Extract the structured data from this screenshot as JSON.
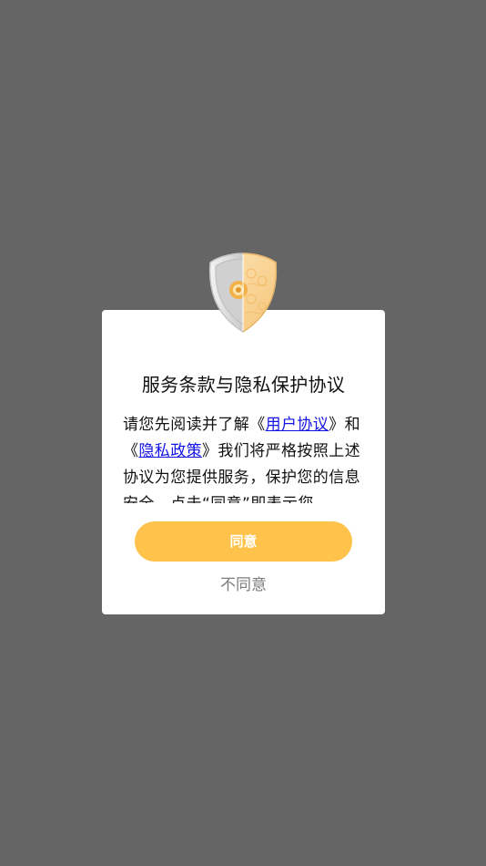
{
  "dialog": {
    "title": "服务条款与隐私保护协议",
    "body": {
      "intro": "请您先阅读并了解《",
      "user_agreement_link": "用户协议",
      "mid": "》和《",
      "privacy_policy_link": "隐私政策",
      "rest": "》我们将严格按照上述协议为您提供服务，保护您的信息安全，点击“同意”即表示您"
    },
    "agree_label": "同意",
    "disagree_label": "不同意"
  },
  "colors": {
    "overlay": "#656565",
    "accent": "#ffc24a",
    "link": "#1414e6"
  },
  "icons": {
    "shield": "privacy-shield-icon"
  }
}
